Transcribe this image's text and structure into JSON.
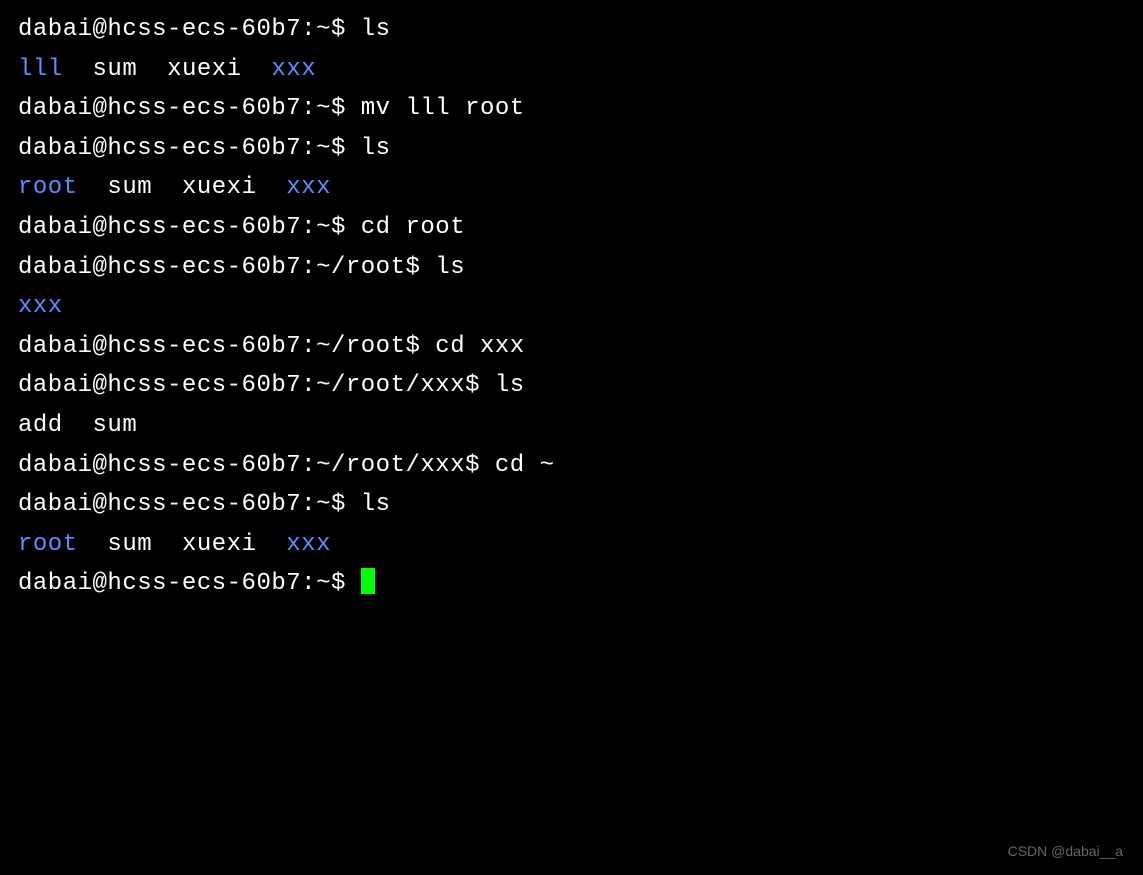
{
  "prompt": {
    "user": "dabai",
    "host": "hcss-ecs-60b7",
    "at": "@",
    "colon": ":",
    "home": "~",
    "dollar": "$ "
  },
  "lines": {
    "l0_cmd": "ls",
    "l1_out_d1": "lll",
    "l1_out_f1": "sum",
    "l1_out_f2": "xuexi",
    "l1_out_d2": "xxx",
    "l2_cmd": "mv lll root",
    "l3_cmd": "ls",
    "l4_out_d1": "root",
    "l4_out_f1": "sum",
    "l4_out_f2": "xuexi",
    "l4_out_d2": "xxx",
    "l5_cmd": "cd root",
    "l6_path": "~/root",
    "l6_cmd": "ls",
    "l7_out_d1": "xxx",
    "l8_path": "~/root",
    "l8_cmd": "cd xxx",
    "l9_path": "~/root/xxx",
    "l9_cmd": "ls",
    "l10_out": "add  sum",
    "l11_path": "~/root/xxx",
    "l11_cmd": "cd ~",
    "l12_cmd": "ls",
    "l13_out_d1": "root",
    "l13_out_f1": "sum",
    "l13_out_f2": "xuexi",
    "l13_out_d2": "xxx"
  },
  "watermark": "CSDN @dabai__a"
}
